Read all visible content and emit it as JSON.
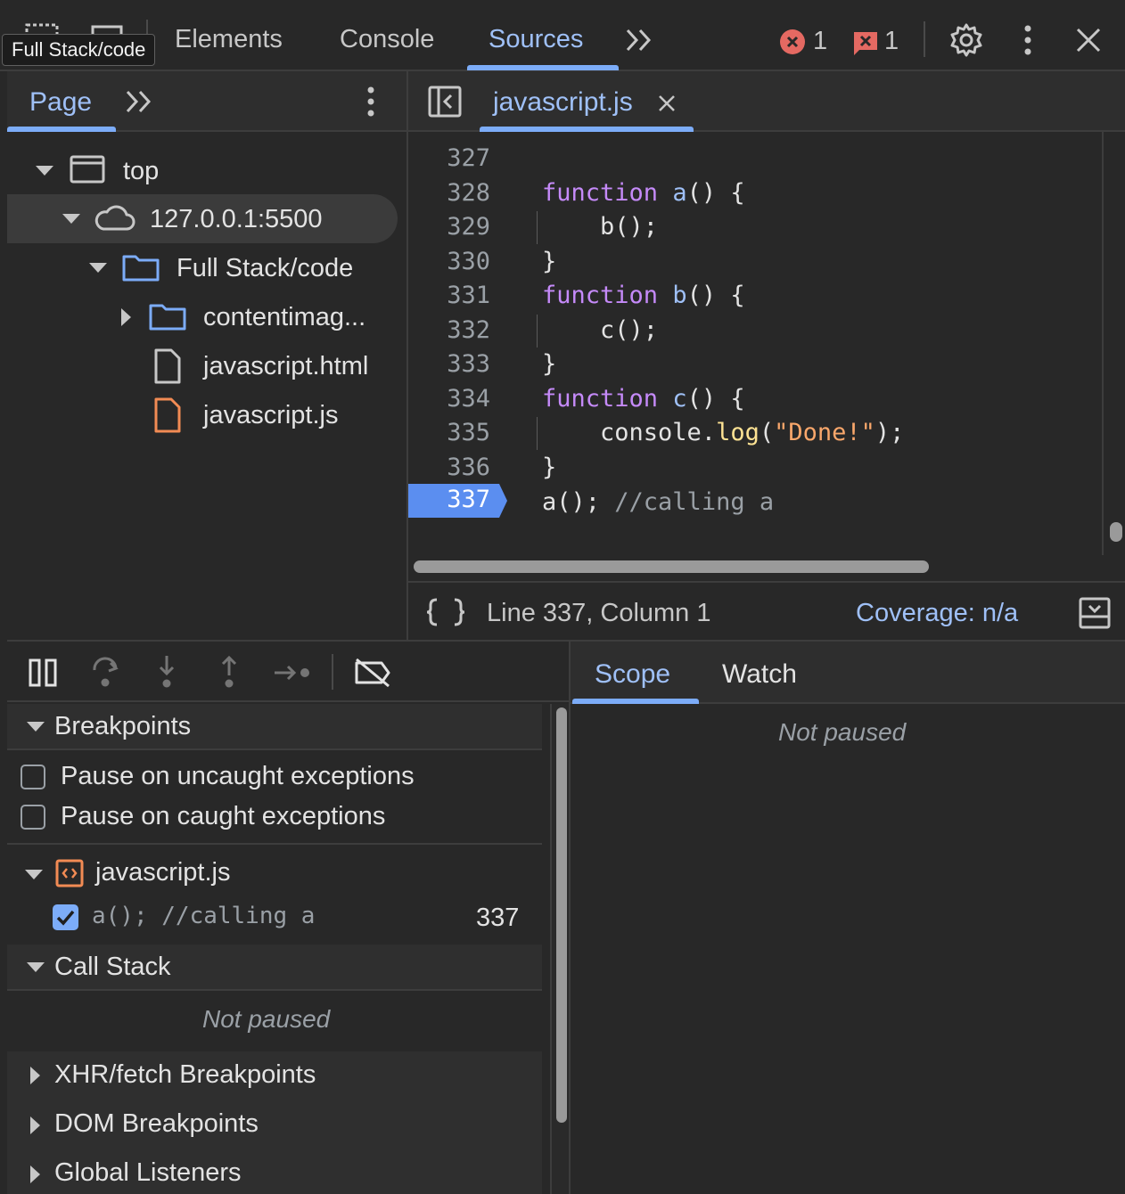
{
  "tooltip": "Full Stack/code",
  "toolbar": {
    "tabs": [
      "Elements",
      "Console",
      "Sources"
    ],
    "error_count": "1",
    "issue_count": "1"
  },
  "navigator": {
    "tab_label": "Page",
    "tree": [
      {
        "label": "top",
        "icon": "frame-icon",
        "expanded": true
      },
      {
        "label": "127.0.0.1:5500",
        "icon": "cloud-icon",
        "expanded": true,
        "selected": true
      },
      {
        "label": "Full Stack/code",
        "icon": "folder-icon",
        "expanded": true
      },
      {
        "label": "contentimag...",
        "icon": "folder-icon",
        "expanded": false
      },
      {
        "label": "javascript.html",
        "icon": "file-icon"
      },
      {
        "label": "javascript.js",
        "icon": "js-file-icon"
      }
    ]
  },
  "editor": {
    "file_tab": "javascript.js",
    "lines": [
      {
        "num": "327",
        "code": ""
      },
      {
        "num": "328",
        "code": "function a() {"
      },
      {
        "num": "329",
        "code": "    b();"
      },
      {
        "num": "330",
        "code": "}"
      },
      {
        "num": "331",
        "code": "function b() {"
      },
      {
        "num": "332",
        "code": "    c();"
      },
      {
        "num": "333",
        "code": "}"
      },
      {
        "num": "334",
        "code": "function c() {"
      },
      {
        "num": "335",
        "code": "    console.log(\"Done!\");"
      },
      {
        "num": "336",
        "code": "}"
      },
      {
        "num": "337",
        "code": "a(); //calling a"
      }
    ],
    "breakpoint_line": "337",
    "status": "Line 337, Column 1",
    "coverage": "Coverage: n/a"
  },
  "debugger": {
    "breakpoints_header": "Breakpoints",
    "pause_uncaught": "Pause on uncaught exceptions",
    "pause_caught": "Pause on caught exceptions",
    "bp_file": "javascript.js",
    "bp_code": "a(); //calling a",
    "bp_line": "337",
    "call_stack_header": "Call Stack",
    "call_stack_status": "Not paused",
    "xhr_header": "XHR/fetch Breakpoints",
    "dom_header": "DOM Breakpoints",
    "global_header": "Global Listeners"
  },
  "scope": {
    "tab_scope": "Scope",
    "tab_watch": "Watch",
    "status": "Not paused"
  },
  "colors": {
    "accent": "#7cacf8",
    "keyword": "#c58af9",
    "string": "#f9a76b",
    "error": "#e46962",
    "js_file": "#f28b54"
  }
}
